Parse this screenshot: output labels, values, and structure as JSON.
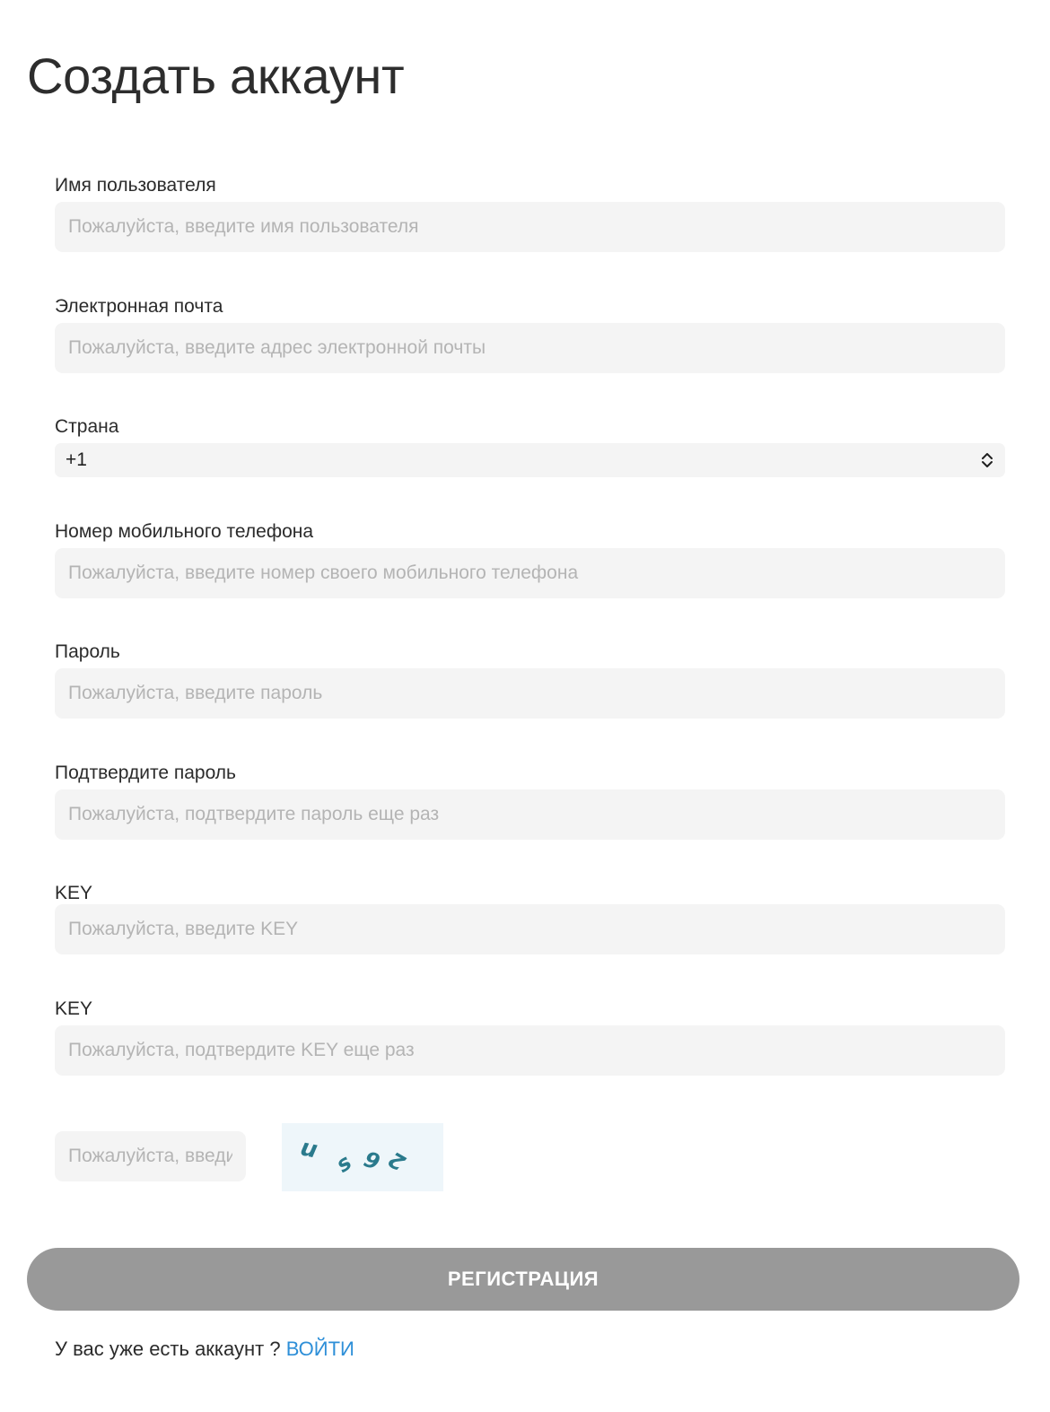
{
  "page": {
    "title": "Создать аккаунт"
  },
  "form": {
    "username": {
      "label": "Имя пользователя",
      "placeholder": "Пожалуйста, введите имя пользователя"
    },
    "email": {
      "label": "Электронная почта",
      "placeholder": "Пожалуйста, введите адрес электронной почты"
    },
    "country": {
      "label": "Страна",
      "selected": "+1"
    },
    "phone": {
      "label": "Номер мобильного телефона",
      "placeholder": "Пожалуйста, введите номер своего мобильного телефона"
    },
    "password": {
      "label": "Пароль",
      "placeholder": "Пожалуйста, введите пароль"
    },
    "password_confirm": {
      "label": "Подтвердите пароль",
      "placeholder": "Пожалуйста, подтвердите пароль еще раз"
    },
    "key": {
      "label": "KEY",
      "placeholder": "Пожалуйста, введите KEY"
    },
    "key_confirm": {
      "label": "KEY",
      "placeholder": "Пожалуйста, подтвердите KEY еще раз"
    },
    "captcha": {
      "placeholder": "Пожалуйста, введите код подтверждения",
      "characters": [
        "u",
        "s",
        "9",
        "2"
      ]
    }
  },
  "actions": {
    "register_label": "РЕГИСТРАЦИЯ",
    "login_prompt": "У вас уже есть аккаунт ?",
    "login_link": "ВОЙТИ"
  },
  "colors": {
    "input_background": "#f4f4f4",
    "placeholder": "#b4b4b4",
    "button_disabled": "#999999",
    "link": "#2e8fd8",
    "captcha_text": "#2a7a8c",
    "captcha_background": "#eef6fa"
  }
}
